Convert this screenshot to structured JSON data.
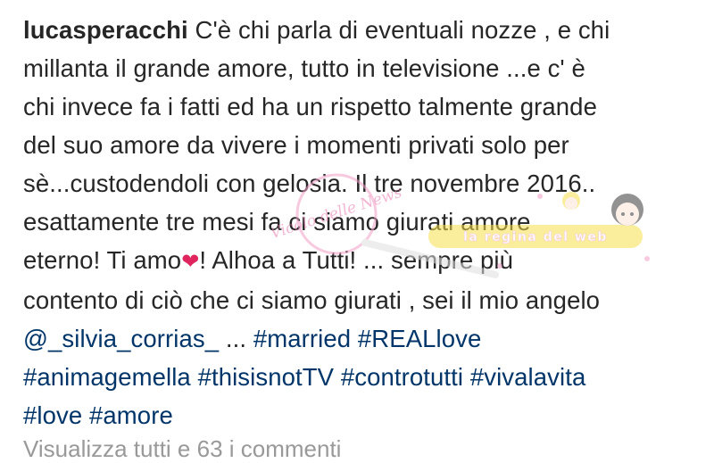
{
  "post": {
    "username": "lucasperacchi",
    "lines": {
      "l1": "C'è chi parla di eventuali nozze , e chi",
      "l2": "millanta il grande amore, tutto in televisione ...e c' è",
      "l3": "chi invece fa i fatti ed ha un rispetto talmente grande",
      "l4": "del suo amore da vivere i momenti privati solo per",
      "l5": "sè...custodendoli con gelosia. Il tre novembre 2016..",
      "l6": "esattamente tre mesi fa ci siamo giurati amore",
      "l7a": "eterno! Ti amo",
      "l7b": "! Alhoa a Tutti! ... sempre più",
      "l8": "contento di ciò che ci siamo giurati , sei il mio angelo"
    },
    "heart_icon": "❤",
    "mention": "@_silvia_corrias_",
    "ellipsis": " ... ",
    "hashtags": {
      "married": "#married",
      "reallove": "#REALlove",
      "animagemella": "#animagemella",
      "thisisnottv": "#thisisnotTV",
      "controtutti": "#controtutti",
      "vivalavita": "#vivalavita",
      "love": "#love",
      "amore": "#amore"
    },
    "view_comments": "Visualizza tutti e 63 i commenti"
  },
  "watermark": {
    "text_left": "Vicolo delle News",
    "text_right": "la regina del web"
  },
  "colors": {
    "text": "#262626",
    "link": "#003569",
    "muted": "#999999",
    "heart": "#e0245e",
    "watermark_pink": "#f2a0c8",
    "watermark_yellow": "#f6e04a"
  }
}
